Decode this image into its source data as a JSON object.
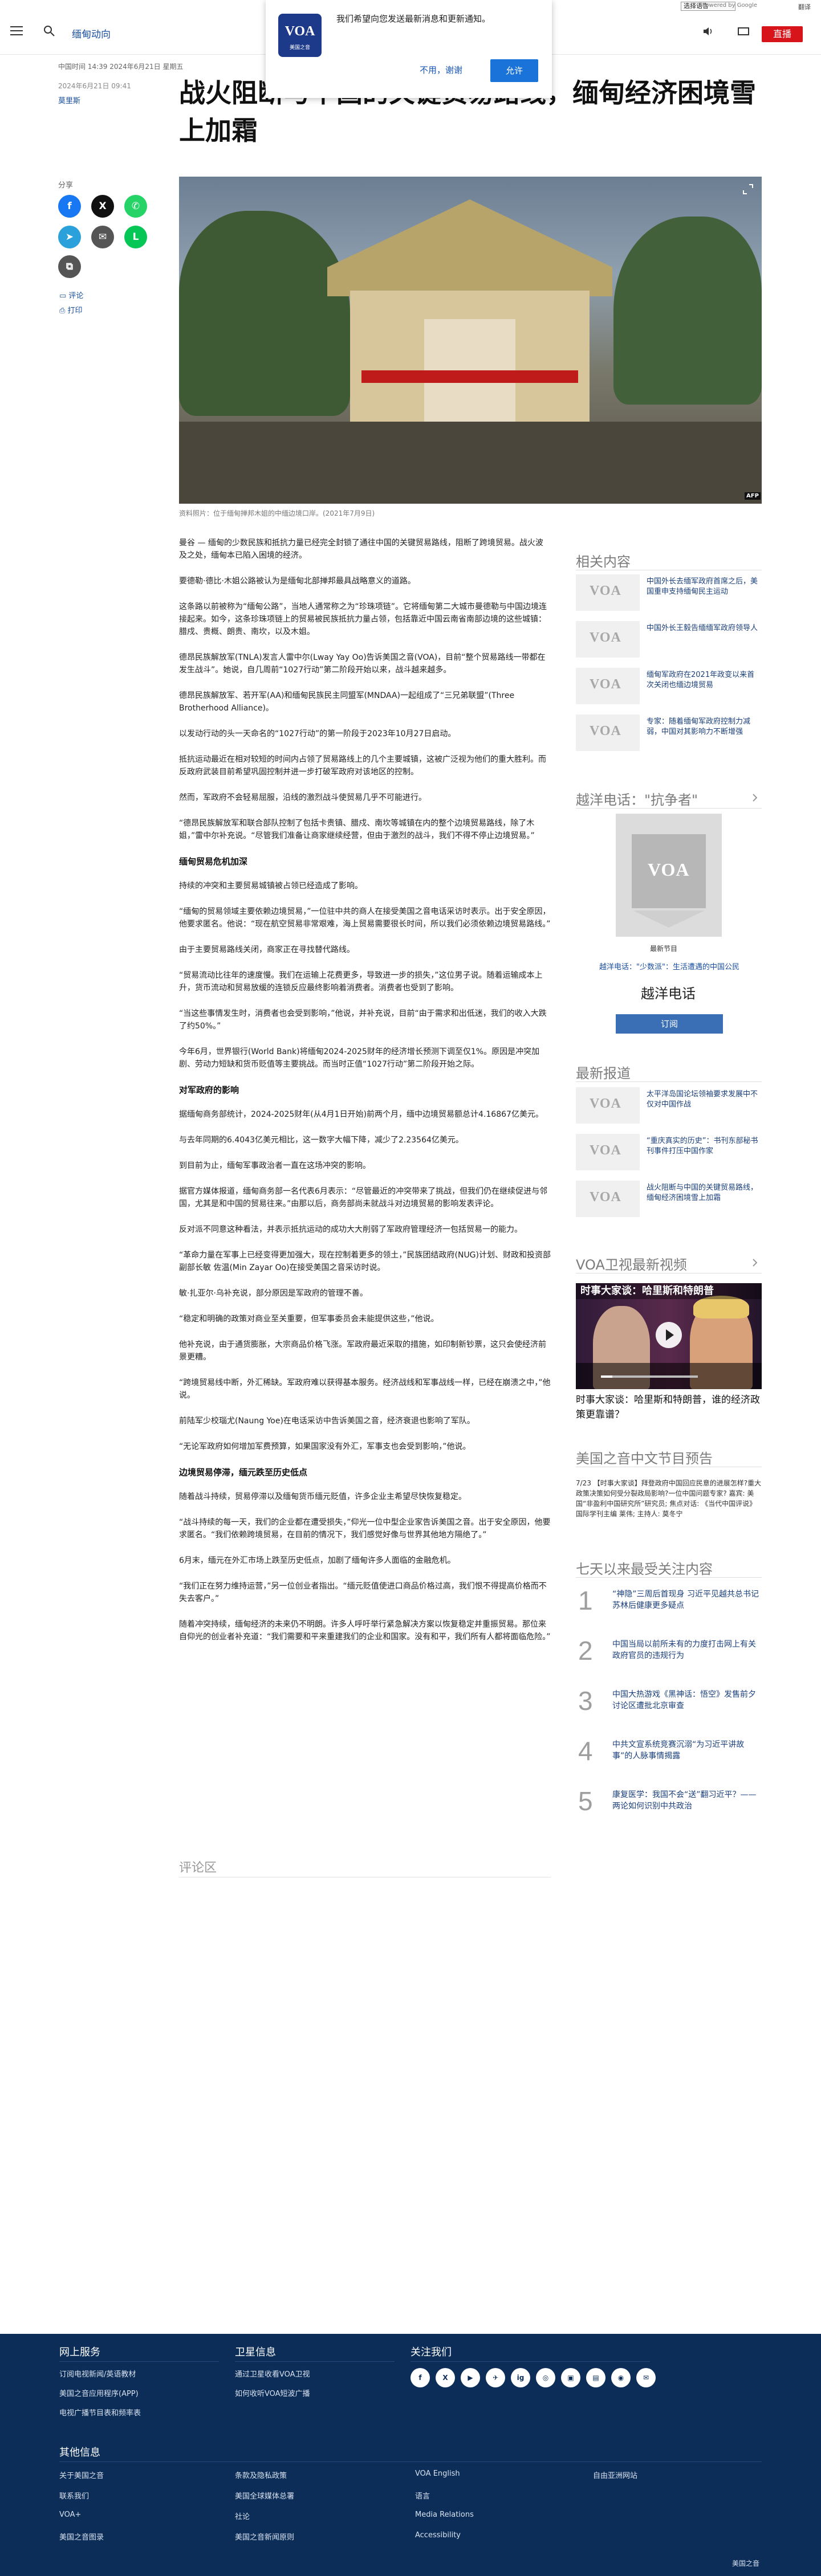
{
  "top_strip": {
    "language_select": "选择语言",
    "google_mark": "Powered by Google",
    "translate_label": "翻译"
  },
  "header": {
    "section_link": "缅甸动向",
    "live_button": "直播"
  },
  "notification": {
    "logo_text": "VOA",
    "logo_sub": "美国之音",
    "message": "我们希望向您发送最新消息和更新通知。",
    "decline": "不用，谢谢",
    "accept": "允许"
  },
  "article": {
    "update_time": "中国时间 14:39 2024年6月21日 星期五",
    "published": "2024年6月21日 09:41",
    "author": "莫里斯",
    "title": "战火阻断与中国的关键贸易路线，缅甸经济困境雪上加霜",
    "share_label": "分享",
    "comment_link": "评论",
    "print_link": "打印",
    "hero_caption": "资料照片：位于缅甸掸邦木姐的中缅边境口岸。(2021年7月9日)",
    "hero_badge": "AFP",
    "paragraphs": [
      {
        "type": "p",
        "text": "曼谷 — 缅甸的少数民族和抵抗力量已经完全封锁了通往中国的关键贸易路线，阻断了跨境贸易。战火波及之处，缅甸本已陷入困境的经济。"
      },
      {
        "type": "p",
        "text": "要德勒·德比·木姐公路被认为是缅甸北部掸邦最具战略意义的道路。"
      },
      {
        "type": "p",
        "text": "这条路以前被称为“缅甸公路”，当地人通常称之为“珍珠项链”。它将缅甸第二大城市曼德勒与中国边境连接起来。如今，这条珍珠项链上的贸易被民族抵抗力量占领，包括靠近中国云南省南部边境的这些城镇：腊戍、贵概、朗贵、南坎，以及木姐。"
      },
      {
        "type": "p",
        "text": "德昂民族解放军(TNLA)发言人雷中尔(Lway Yay Oo)告诉美国之音(VOA)，目前“整个贸易路线一带都在发生战斗”。她说，自几周前“1027行动”第二阶段开始以来，战斗越来越多。"
      },
      {
        "type": "p",
        "text": "德昂民族解放军、若开军(AA)和缅甸民族民主同盟军(MNDAA)一起组成了“三兄弟联盟”(Three Brotherhood Alliance)。"
      },
      {
        "type": "p",
        "text": "以发动行动的头一天命名的“1027行动”的第一阶段于2023年10月27日启动。"
      },
      {
        "type": "p",
        "text": "抵抗运动最近在相对较短的时间内占领了贸易路线上的几个主要城镇，这被广泛视为他们的重大胜利。而反政府武装目前希望巩固控制并进一步打破军政府对该地区的控制。"
      },
      {
        "type": "p",
        "text": "然而，军政府不会轻易屈服，沿线的激烈战斗使贸易几乎不可能进行。"
      },
      {
        "type": "p",
        "text": "“德昂民族解放军和联合部队控制了包括卡贵镇、腊戍、南坎等城镇在内的整个边境贸易路线，除了木姐，”雷中尔补充说。“尽管我们准备让商家继续经营，但由于激烈的战斗，我们不得不停止边境贸易。”"
      },
      {
        "type": "h",
        "text": "缅甸贸易危机加深"
      },
      {
        "type": "p",
        "text": "持续的冲突和主要贸易城镇被占领已经造成了影响。"
      },
      {
        "type": "p",
        "text": "“缅甸的贸易领域主要依赖边境贸易，”一位驻中共的商人在接受美国之音电话采访时表示。出于安全原因，他要求匿名。他说：“现在航空贸易非常艰难，海上贸易需要很长时间，所以我们必须依赖边境贸易路线。”"
      },
      {
        "type": "p",
        "text": "由于主要贸易路线关闭，商家正在寻找替代路线。"
      },
      {
        "type": "p",
        "text": "“贸易流动比往年的速度慢。我们在运输上花费更多，导致进一步的损失，”这位男子说。随着运输成本上升，货币流动和贸易放缓的连锁反应最终影响着消费者。消费者也受到了影响。"
      },
      {
        "type": "p",
        "text": "“当这些事情发生时，消费者也会受到影响，”他说，并补充说，目前“由于需求和出低迷，我们的收入大跌了约50%。”"
      },
      {
        "type": "p",
        "text": "今年6月，世界银行(World Bank)将缅甸2024-2025财年的经济增长预测下调至仅1%。原因是冲突加剧、劳动力短缺和货币贬值等主要挑战。而当时正值“1027行动”第二阶段开始之际。"
      },
      {
        "type": "h",
        "text": "对军政府的影响"
      },
      {
        "type": "p",
        "text": "据缅甸商务部统计，2024-2025财年(从4月1日开始)前两个月，缅中边境贸易额总计4.16867亿美元。"
      },
      {
        "type": "p",
        "text": "与去年同期的6.4043亿美元相比，这一数字大幅下降，减少了2.23564亿美元。"
      },
      {
        "type": "p",
        "text": "到目前为止，缅甸军事政治者一直在这场冲突的影响。"
      },
      {
        "type": "p",
        "text": "据官方媒体报道，缅甸商务部一名代表6月表示：“尽管最近的冲突带来了挑战，但我们仍在继续促进与邻国，尤其是和中国的贸易往来。”由那以后，商务部尚未就战斗对边境贸易的影响发表评论。"
      },
      {
        "type": "p",
        "text": "反对派不同意这种看法，并表示抵抗运动的成功大大削弱了军政府管理经济一包括贸易一的能力。"
      },
      {
        "type": "p",
        "text": "“革命力量在军事上已经变得更加强大，现在控制着更多的领土，”民族团结政府(NUG)计划、财政和投资部副部长敏 佐温(Min Zayar Oo)在接受美国之音采访时说。"
      },
      {
        "type": "p",
        "text": "敏·扎亚尔·乌补充说，部分原因是军政府的管理不善。"
      },
      {
        "type": "p",
        "text": "“稳定和明确的政策对商业至关重要，但军事委员会未能提供这些，”他说。"
      },
      {
        "type": "p",
        "text": "他补充说，由于通货膨胀，大宗商品价格飞涨。军政府最近采取的措施，如印制新钞票，这只会使经济前景更糟。"
      },
      {
        "type": "p",
        "text": "“跨境贸易线中断，外汇稀缺。军政府难以获得基本服务。经济战线和军事战线一样，已经在崩溃之中，”他说。"
      },
      {
        "type": "p",
        "text": "前陆军少校瑙尤(Naung Yoe)在电话采访中告诉美国之音，经济衰退也影响了军队。"
      },
      {
        "type": "p",
        "text": "“无论军政府如何增加军费预算，如果国家没有外汇，军事支也会受到影响，”他说。"
      },
      {
        "type": "h",
        "text": "边境贸易停滞，缅元跌至历史低点"
      },
      {
        "type": "p",
        "text": "随着战斗持续，贸易停滞以及缅甸货币缅元贬值，许多企业主希望尽快恢复稳定。"
      },
      {
        "type": "p",
        "text": "“战斗持续的每一天，我们的企业都在遭受损失，”仰光一位中型企业家告诉美国之音。出于安全原因，他要求匿名。“我们依赖跨境贸易，在目前的情况下，我们感觉好像与世界其他地方隔绝了。”"
      },
      {
        "type": "p",
        "text": "6月末，缅元在外汇市场上跌至历史低点，加剧了缅甸许多人面临的金融危机。"
      },
      {
        "type": "p",
        "text": "“我们正在努力维持运营，”另一位创业者指出。“缅元贬值使进口商品价格过高，我们恨不得提高价格而不失去客户。”"
      },
      {
        "type": "p",
        "text": "随着冲突持续，缅甸经济的未来仍不明朗。许多人呼吁举行紧急解决方案以恢复稳定并重振贸易。那位来自仰光的创业者补充道：“我们需要和平来重建我们的企业和国家。没有和平，我们所有人都将面临危险。”"
      }
    ],
    "comments_title": "评论区"
  },
  "sidebar": {
    "related_title": "相关内容",
    "related": [
      {
        "text": "中国外长去缅军政府首席之后，美国重申支持缅甸民主运动"
      },
      {
        "text": "中国外长王毅告缅缅军政府领导人"
      },
      {
        "text": "缅甸军政府在2021年政变以来首次关闭也缅边境贸易"
      },
      {
        "text": "专家：随着缅甸军政府控制力减弱，中国对其影响力不断增强"
      }
    ],
    "podcast_section": "越洋电话：\"抗争者\"",
    "latest_episode_label": "最新节目",
    "latest_episode_link": "越洋电话：\"少数派\"：生活遭遇的中国公民",
    "podcast_name": "越洋电话",
    "subscribe": "订阅",
    "latest_title": "最新报道",
    "latest": [
      {
        "text": "太平洋岛国论坛领袖要求发展中不仅对中国作战"
      },
      {
        "text": "“重庆真实的历史”：书刊东部秘书刊事件打压中国作家"
      },
      {
        "text": "战火阻断与中国的关键贸易路线，缅甸经济困境雪上加霜"
      }
    ],
    "video_title": "VOA卫视最新视频",
    "video_overlay": "时事大家谈：哈里斯和特朗普",
    "video_caption": "时事大家谈：哈里斯和特朗普，谁的经济政策更靠谱？",
    "preview_title": "美国之音中文节目预告",
    "preview_text": "7/23 【时事大家谈】拜登政府中国回应民意的进展怎样?重大政策决策如何受分裂政局影响?一位中国问题专家? 嘉宾: 美国“非盈利中国研究所”研究员; 焦点对话: 《当代中国评说》国际学刊主编 莱伟; 主持人: 莫冬宁",
    "popular_title": "七天以来最受关注内容",
    "popular": [
      {
        "num": "1",
        "text": "“神隐”三周后首现身 习近平见越共总书记苏林后健康更多疑点"
      },
      {
        "num": "2",
        "text": "中国当局以前所未有的力度打击网上有关政府官员的违规行为"
      },
      {
        "num": "3",
        "text": "中国大热游戏《黑神话：悟空》发售前夕讨论区遭批北京审查"
      },
      {
        "num": "4",
        "text": "中共文宣系统竞赛沉溺“为习近平讲故事”的人脉事情揭露"
      },
      {
        "num": "5",
        "text": "康复医学：我国不会“送”翻习近平？——两论如何识别中共政治"
      }
    ]
  },
  "footer": {
    "col1_title": "网上服务",
    "col1_links": [
      "订阅电视新闻/英语教材",
      "美国之音应用程序(APP)",
      "电视广播节目表和频率表"
    ],
    "col2_title": "卫星信息",
    "col2_links": [
      "通过卫星收看VOA卫视",
      "如何收听VOA短波广播"
    ],
    "col3_title": "关注我们",
    "social": [
      "f",
      "X",
      "▶",
      "✈",
      "ig",
      "◎",
      "▣",
      "▤",
      "◉",
      "✉"
    ],
    "other_title": "其他信息",
    "other_links": [
      [
        "关于美国之音",
        "条款及隐私政策",
        "VOA English",
        "自由亚洲网站"
      ],
      [
        "联系我们",
        "美国全球媒体总署",
        "语言",
        ""
      ],
      [
        "VOA+",
        "社论",
        "Media Relations",
        ""
      ],
      [
        "美国之音图录",
        "美国之音新闻原则",
        "Accessibility",
        ""
      ]
    ],
    "copyright": "美国之音"
  }
}
